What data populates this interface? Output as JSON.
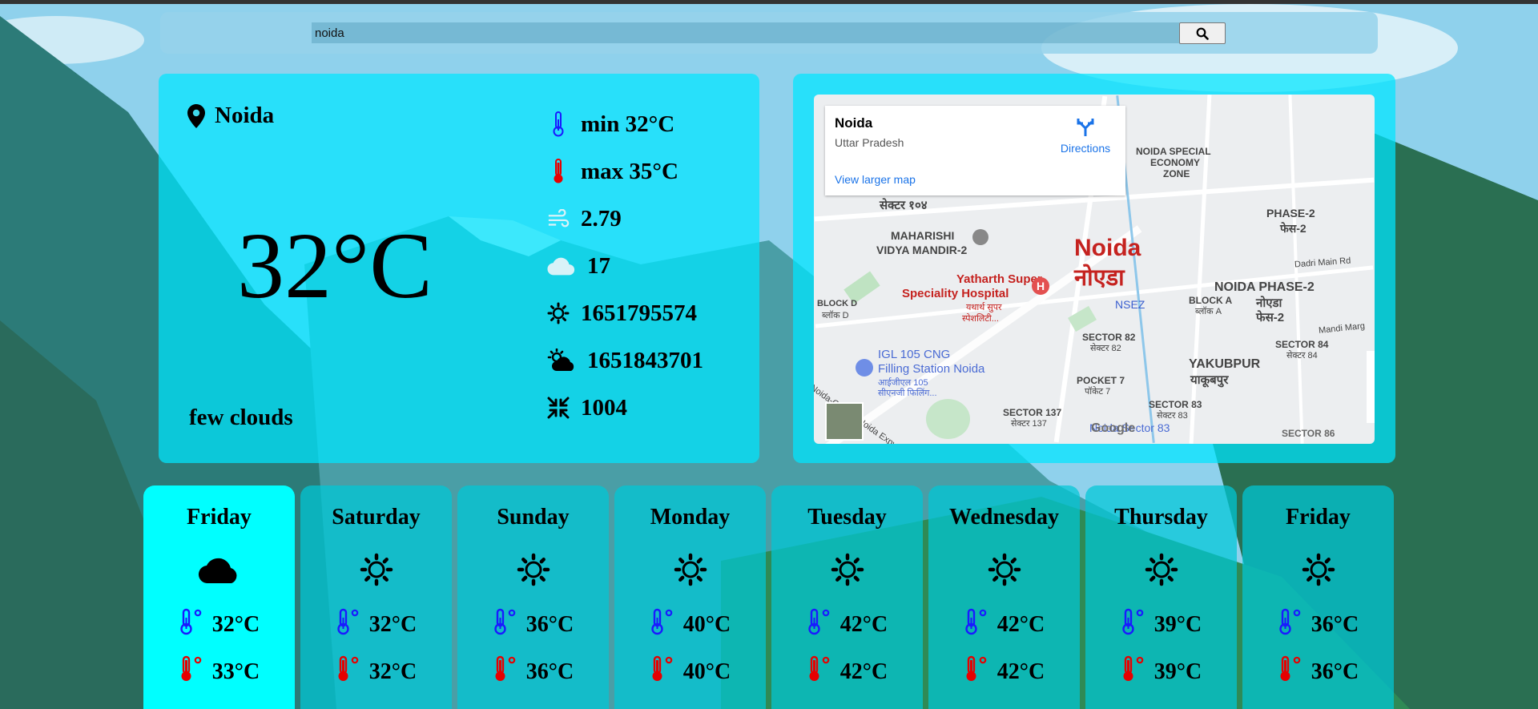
{
  "search": {
    "value": "noida"
  },
  "current": {
    "city": "Noida",
    "temperature": "32°C",
    "description": "few clouds",
    "stats": [
      {
        "icon": "thermometer-cold-icon",
        "text": "min 32°C"
      },
      {
        "icon": "thermometer-hot-icon",
        "text": "max 35°C"
      },
      {
        "icon": "wind-icon",
        "text": "2.79"
      },
      {
        "icon": "cloud-icon",
        "text": "17"
      },
      {
        "icon": "sunrise-gear-icon",
        "text": "1651795574"
      },
      {
        "icon": "sunset-cloud-icon",
        "text": "1651843701"
      },
      {
        "icon": "pressure-compress-icon",
        "text": "1004"
      }
    ]
  },
  "map": {
    "place_name": "Noida",
    "place_region": "Uttar Pradesh",
    "directions": "Directions",
    "larger_map": "View larger map",
    "labels": {
      "noida": "Noida",
      "noida_hi": "नोएडा",
      "hospital": "Yatharth Super",
      "hospital2": "Speciality Hospital",
      "hospital_hi": "यथार्थ सुपर",
      "hospital_hi2": "स्पेशलिटी...",
      "maharishi": "MAHARISHI",
      "maharishi2": "VIDYA MANDIR-2",
      "phase2": "PHASE-2",
      "phase2_hi": "फेस-2",
      "noida_phase2": "NOIDA PHASE-2",
      "noida_phase2_hi": "नोएडा",
      "noida_phase2_hi2": "फेस-2",
      "special_economy": "NOIDA SPECIAL",
      "special_economy2": "ECONOMY",
      "special_economy3": "ZONE",
      "yakubpur": "YAKUBPUR",
      "yakubpur_hi": "याकूबपुर",
      "igl": "IGL 105 CNG",
      "igl2": "Filling Station Noida",
      "igl_hi": "आईजीएल 105",
      "igl_hi2": "सीएनजी फिलिंग...",
      "sector82": "SECTOR 82",
      "sector82_hi": "सेक्टर 82",
      "sector84": "SECTOR 84",
      "sector84_hi": "सेक्टर 84",
      "sector83": "SECTOR 83",
      "sector83_hi": "सेक्टर 83",
      "sector137": "SECTOR 137",
      "sector137_hi": "सेक्टर 137",
      "sector86": "SECTOR 86",
      "sector104_hi": "सेक्टर १०४",
      "pocket7": "POCKET 7",
      "pocket7_hi": "पॉकेट 7",
      "block_d": "BLOCK D",
      "block_d_hi": "ब्लॉक D",
      "block_a": "BLOCK A",
      "block_a_hi": "ब्लॉक A",
      "nsez": "NSEZ",
      "dadri": "Dadri Main Rd",
      "mandi": "Mandi Marg",
      "google": "Google",
      "noida_sector83": "Noida Sector 83",
      "expressway": "Noida-Greater Noida Expy"
    }
  },
  "forecast": [
    {
      "day": "Friday",
      "icon": "cloud-icon",
      "min": "32°C",
      "max": "33°C"
    },
    {
      "day": "Saturday",
      "icon": "sun-icon",
      "min": "32°C",
      "max": "32°C"
    },
    {
      "day": "Sunday",
      "icon": "sun-icon",
      "min": "36°C",
      "max": "36°C"
    },
    {
      "day": "Monday",
      "icon": "sun-icon",
      "min": "40°C",
      "max": "40°C"
    },
    {
      "day": "Tuesday",
      "icon": "sun-icon",
      "min": "42°C",
      "max": "42°C"
    },
    {
      "day": "Wednesday",
      "icon": "sun-icon",
      "min": "42°C",
      "max": "42°C"
    },
    {
      "day": "Thursday",
      "icon": "sun-icon",
      "min": "39°C",
      "max": "39°C"
    },
    {
      "day": "Friday",
      "icon": "sun-icon",
      "min": "36°C",
      "max": "36°C"
    }
  ],
  "colors": {
    "panel": "#00e6ff",
    "active_day": "#00ffff",
    "cold": "#1a1aff",
    "hot": "#e60000"
  }
}
